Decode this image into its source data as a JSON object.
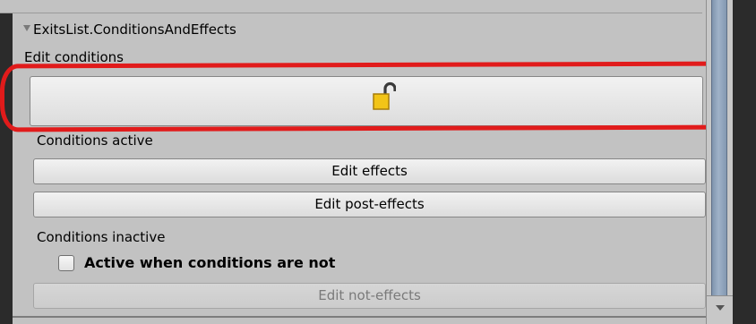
{
  "inspector": {
    "foldout_title": "ExitsList.ConditionsAndEffects",
    "edit_conditions_label": "Edit conditions",
    "lock_button_icon": "unlocked-padlock-icon",
    "conditions_active_label": "Conditions active",
    "edit_effects_label": "Edit effects",
    "edit_post_effects_label": "Edit post-effects",
    "conditions_inactive_label": "Conditions inactive",
    "active_when_not_label": "Active when conditions are not",
    "active_when_not_checked": false,
    "edit_not_effects_label": "Edit not-effects"
  },
  "colors": {
    "highlight": "#e11b1b",
    "lock_body": "#f2c417",
    "panel": "#c2c2c2",
    "scroll_thumb": "#8fa3bb"
  }
}
